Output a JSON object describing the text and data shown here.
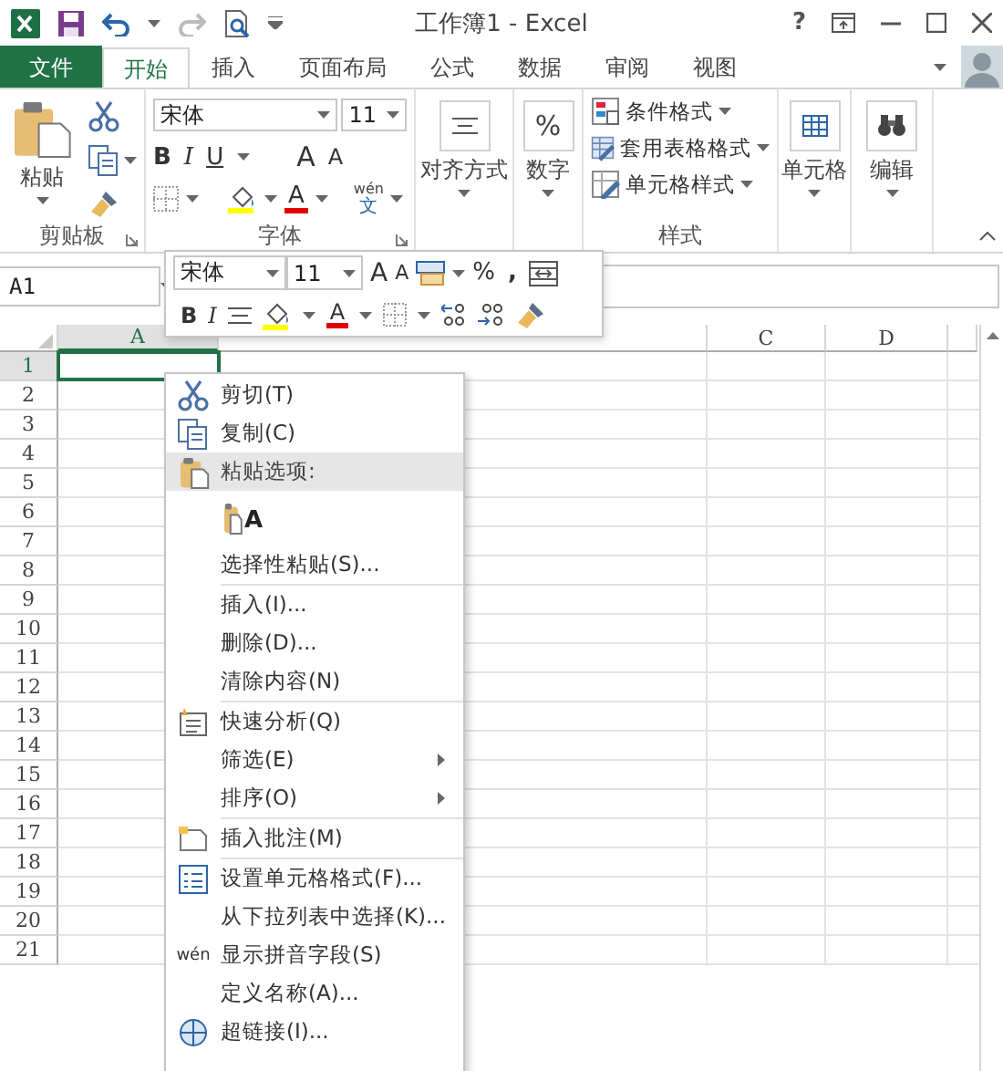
{
  "title_bar": {
    "title": "工作簿1 - Excel",
    "help": "?"
  },
  "tabs": [
    {
      "label": "文件",
      "kind": "file",
      "selected": false
    },
    {
      "label": "开始",
      "kind": "tab",
      "selected": true
    },
    {
      "label": "插入",
      "kind": "tab",
      "selected": false
    },
    {
      "label": "页面布局",
      "kind": "tab",
      "selected": false
    },
    {
      "label": "公式",
      "kind": "tab",
      "selected": false
    },
    {
      "label": "数据",
      "kind": "tab",
      "selected": false
    },
    {
      "label": "审阅",
      "kind": "tab",
      "selected": false
    },
    {
      "label": "视图",
      "kind": "tab",
      "selected": false
    }
  ],
  "ribbon": {
    "clipboard": {
      "paste": "粘贴",
      "label": "剪贴板"
    },
    "font": {
      "font_name": "宋体",
      "font_size": "11",
      "bold": "B",
      "italic": "I",
      "underline": "U",
      "grow_font": "A",
      "shrink_font": "A",
      "font_color": "A",
      "phonetic": "wén",
      "phonetic_char": "文",
      "label": "字体"
    },
    "alignment": {
      "label": "对齐方式"
    },
    "number": {
      "symbol": "%",
      "label": "数字"
    },
    "styles": {
      "items": [
        "条件格式",
        "套用表格格式",
        "单元格样式"
      ],
      "label": "样式"
    },
    "cells": {
      "label": "单元格"
    },
    "editing": {
      "label": "编辑"
    }
  },
  "name_box": "A1",
  "mini_toolbar": {
    "font_name": "宋体",
    "font_size": "11",
    "grow_font": "A",
    "shrink_font": "A",
    "percent": "%",
    "comma": ",",
    "bold": "B",
    "italic": "I",
    "font_color": "A"
  },
  "grid": {
    "columns": [
      {
        "label": "A",
        "selected": true
      },
      {
        "selected": false
      },
      {
        "label": "C",
        "selected": false
      },
      {
        "label": "D",
        "selected": false
      },
      {
        "selected": false
      }
    ],
    "rows": [
      {
        "label": "1",
        "selected": true
      },
      {
        "label": "2",
        "selected": false
      },
      {
        "label": "3",
        "selected": false
      },
      {
        "label": "4",
        "selected": false
      },
      {
        "label": "5",
        "selected": false
      },
      {
        "label": "6",
        "selected": false
      },
      {
        "label": "7",
        "selected": false
      },
      {
        "label": "8",
        "selected": false
      },
      {
        "label": "9",
        "selected": false
      },
      {
        "label": "10",
        "selected": false
      },
      {
        "label": "11",
        "selected": false
      },
      {
        "label": "12",
        "selected": false
      },
      {
        "label": "13",
        "selected": false
      },
      {
        "label": "14",
        "selected": false
      },
      {
        "label": "15",
        "selected": false
      },
      {
        "label": "16",
        "selected": false
      },
      {
        "label": "17",
        "selected": false
      },
      {
        "label": "18",
        "selected": false
      },
      {
        "label": "19",
        "selected": false
      },
      {
        "label": "20",
        "selected": false
      },
      {
        "label": "21",
        "selected": false
      }
    ]
  },
  "context_menu": {
    "items": [
      {
        "kind": "command",
        "label": "剪切(T)",
        "highlighted": false
      },
      {
        "kind": "command",
        "label": "复制(C)",
        "highlighted": false
      },
      {
        "kind": "header",
        "label": "粘贴选项:",
        "highlighted": true
      },
      {
        "kind": "paste_option",
        "label": "A",
        "highlighted": false
      },
      {
        "kind": "command",
        "label": "选择性粘贴(S)...",
        "highlighted": false
      },
      {
        "kind": "separator"
      },
      {
        "kind": "command",
        "label": "插入(I)...",
        "highlighted": false
      },
      {
        "kind": "command",
        "label": "删除(D)...",
        "highlighted": false
      },
      {
        "kind": "command",
        "label": "清除内容(N)",
        "highlighted": false
      },
      {
        "kind": "separator"
      },
      {
        "kind": "command",
        "label": "快速分析(Q)",
        "highlighted": false
      },
      {
        "kind": "submenu",
        "label": "筛选(E)",
        "highlighted": false
      },
      {
        "kind": "submenu",
        "label": "排序(O)",
        "highlighted": false
      },
      {
        "kind": "separator"
      },
      {
        "kind": "command",
        "label": "插入批注(M)",
        "highlighted": false
      },
      {
        "kind": "separator"
      },
      {
        "kind": "command",
        "label": "设置单元格格式(F)...",
        "highlighted": false
      },
      {
        "kind": "command",
        "label": "从下拉列表中选择(K)...",
        "highlighted": false
      },
      {
        "kind": "command",
        "label": "显示拼音字段(S)",
        "icon_text": "wén",
        "highlighted": false
      },
      {
        "kind": "command",
        "label": "定义名称(A)...",
        "highlighted": false
      },
      {
        "kind": "command",
        "label": "超链接(I)...",
        "highlighted": false
      }
    ]
  }
}
